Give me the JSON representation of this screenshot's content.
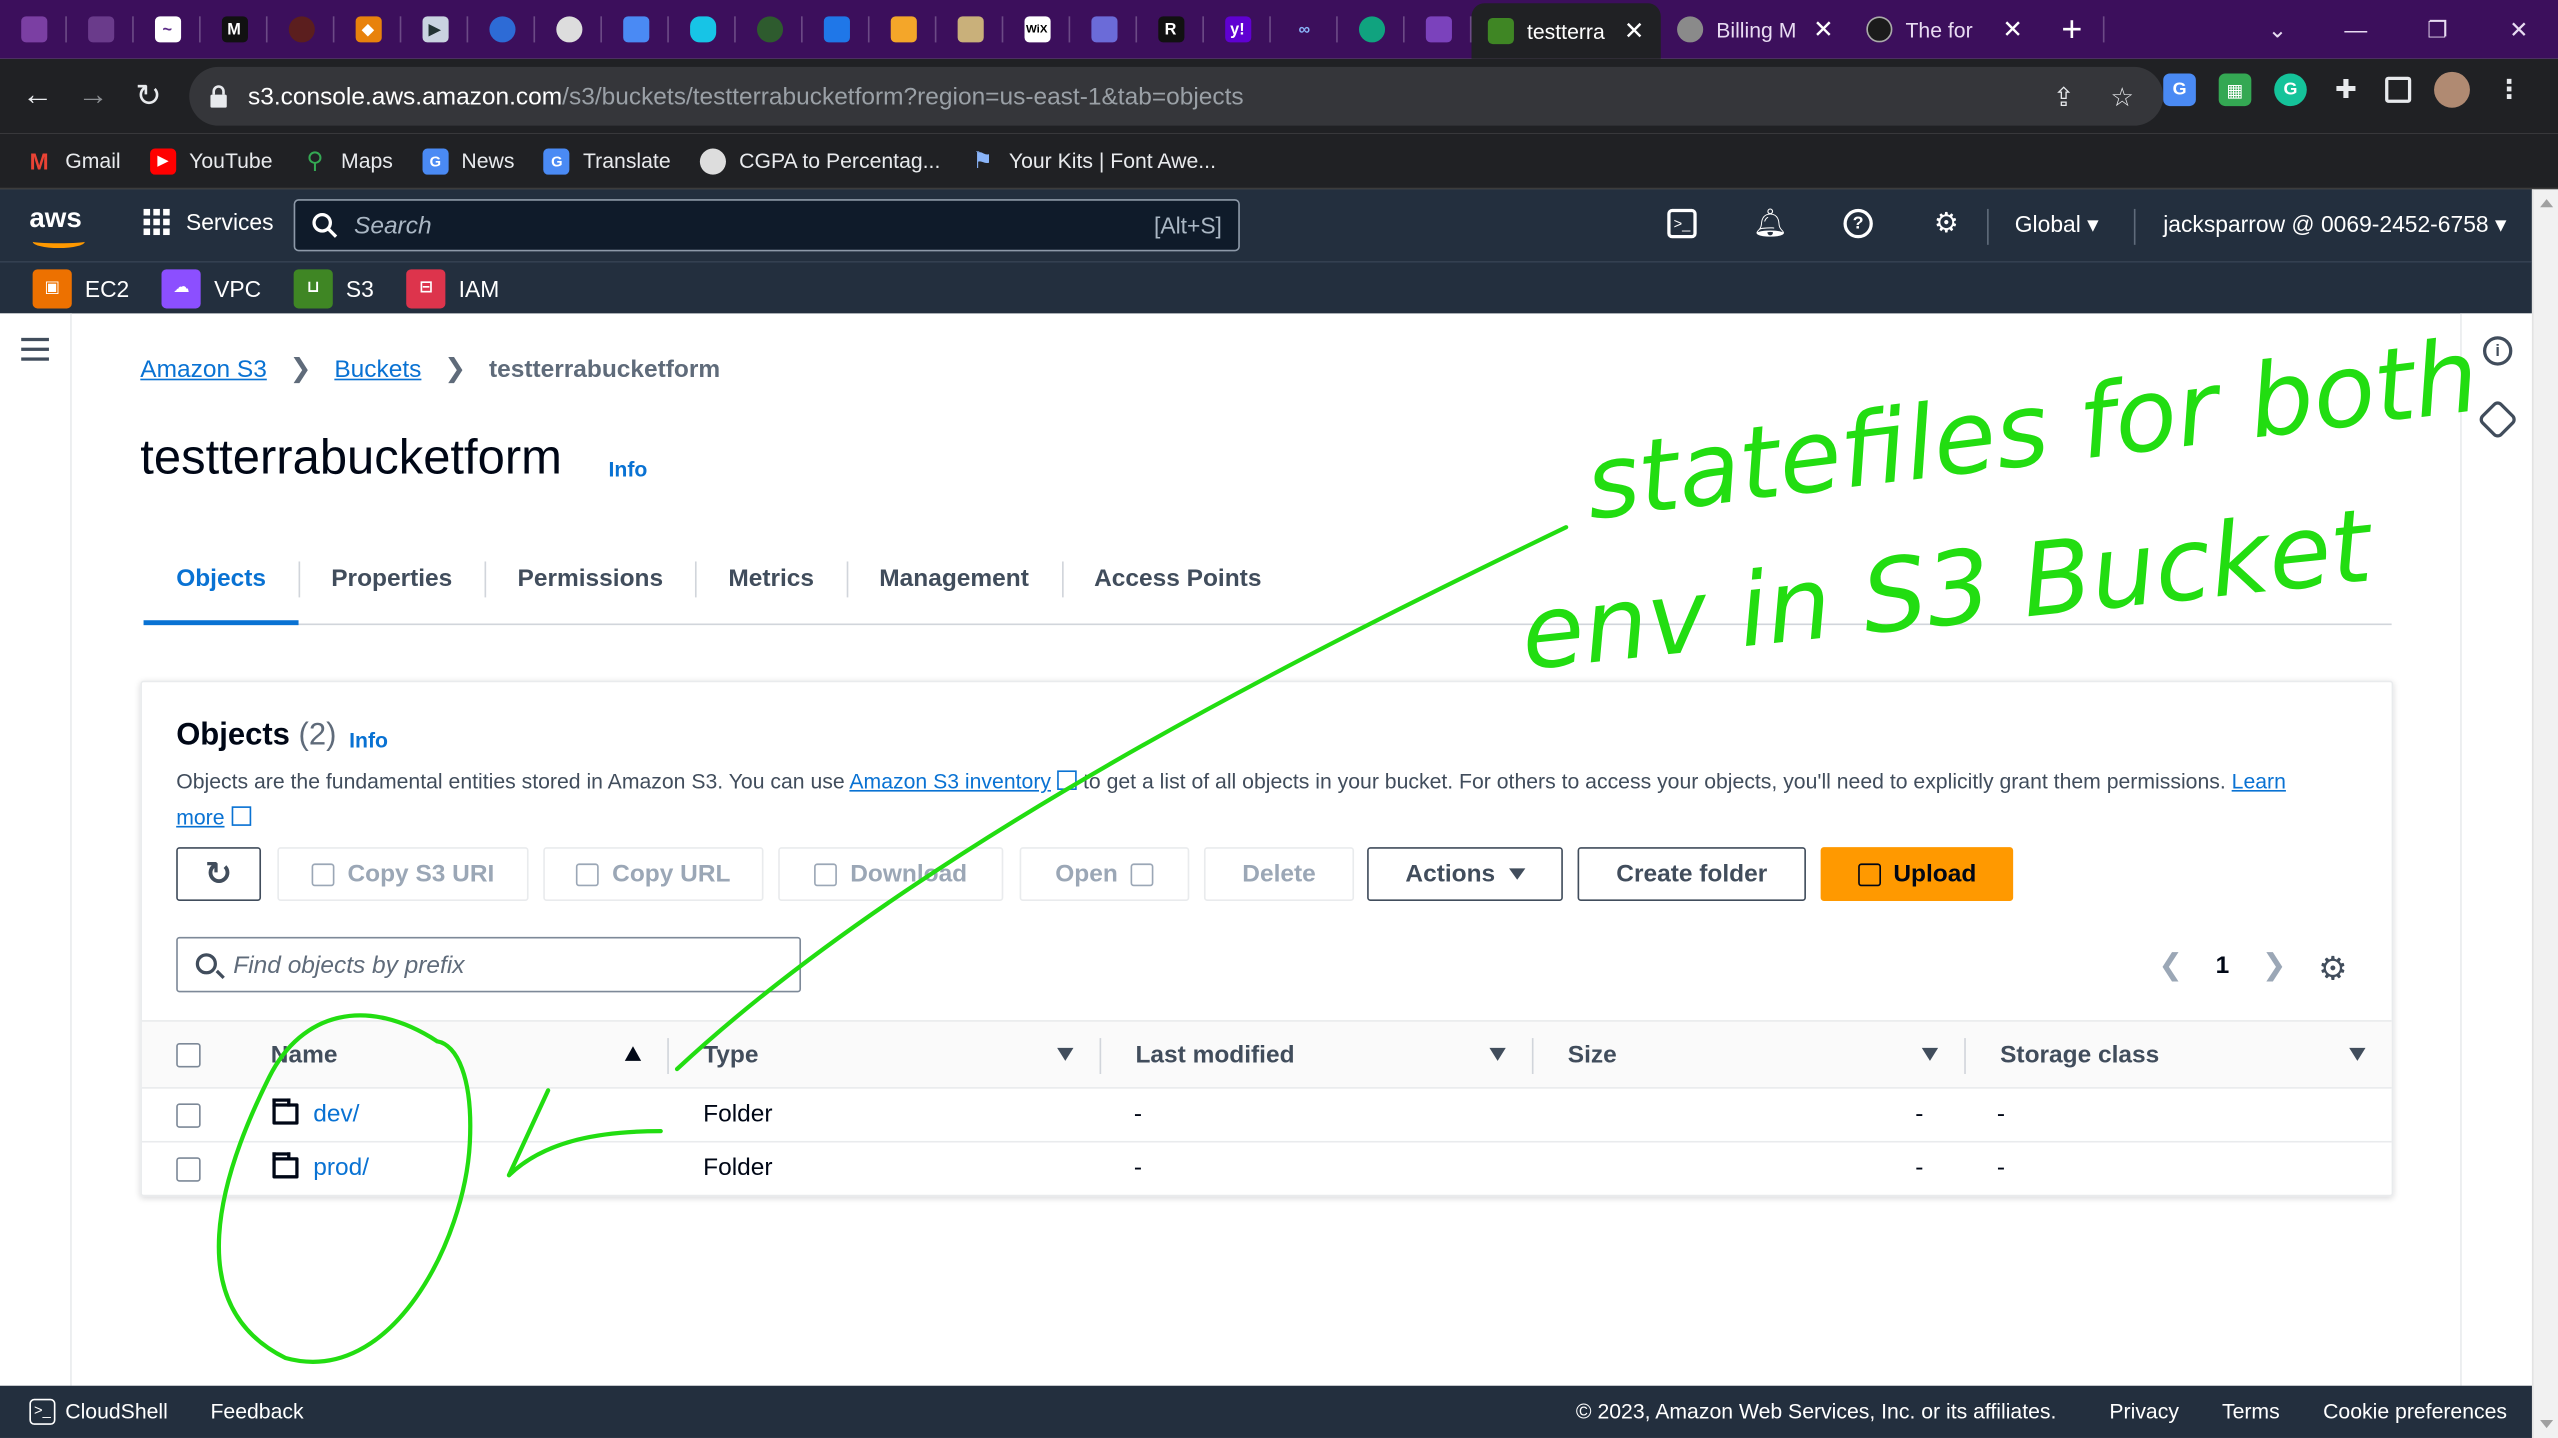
{
  "browser": {
    "tabs": [
      {
        "title": "testterra",
        "active": true
      },
      {
        "title": "Billing M",
        "active": false
      },
      {
        "title": "The for",
        "active": false
      }
    ],
    "url_host": "s3.console.aws.amazon.com",
    "url_rest": "/s3/buckets/testterrabucketform?region=us-east-1&tab=objects",
    "bookmarks": [
      "Gmail",
      "YouTube",
      "Maps",
      "News",
      "Translate",
      "CGPA to Percentag...",
      "Your Kits | Font Awe..."
    ]
  },
  "aws_nav": {
    "logo": "aws",
    "services_label": "Services",
    "search_placeholder": "Search",
    "search_shortcut": "[Alt+S]",
    "region": "Global ▾",
    "account": "jacksparrow @ 0069-2452-6758 ▾",
    "favorites": [
      "EC2",
      "VPC",
      "S3",
      "IAM"
    ]
  },
  "breadcrumb": [
    "Amazon S3",
    "Buckets",
    "testterrabucketform"
  ],
  "page": {
    "title": "testterrabucketform",
    "info": "Info"
  },
  "tabs": [
    "Objects",
    "Properties",
    "Permissions",
    "Metrics",
    "Management",
    "Access Points"
  ],
  "objects_panel": {
    "title": "Objects",
    "count": "(2)",
    "info": "Info",
    "desc_before": "Objects are the fundamental entities stored in Amazon S3. You can use ",
    "desc_link": "Amazon S3 inventory",
    "desc_after": " to get a list of all objects in your bucket. For others to access your objects, you'll need to explicitly grant them permissions. ",
    "desc_learn": "Learn",
    "desc_more": "more",
    "buttons": {
      "copy_s3_uri": "Copy S3 URI",
      "copy_url": "Copy URL",
      "download": "Download",
      "open": "Open",
      "delete": "Delete",
      "actions": "Actions",
      "create_folder": "Create folder",
      "upload": "Upload"
    },
    "filter_placeholder": "Find objects by prefix",
    "page_number": "1",
    "columns": [
      "Name",
      "Type",
      "Last modified",
      "Size",
      "Storage class"
    ],
    "rows": [
      {
        "name": "dev/",
        "type": "Folder",
        "last_modified": "-",
        "size": "-",
        "storage_class": "-"
      },
      {
        "name": "prod/",
        "type": "Folder",
        "last_modified": "-",
        "size": "-",
        "storage_class": "-"
      }
    ]
  },
  "annotation": {
    "line1": "statefiles for both",
    "line2": "env in S3 Bucket",
    "color": "#22dd11"
  },
  "footer": {
    "cloudshell": "CloudShell",
    "feedback": "Feedback",
    "copyright": "© 2023, Amazon Web Services, Inc. or its affiliates.",
    "privacy": "Privacy",
    "terms": "Terms",
    "cookie": "Cookie preferences"
  },
  "colors": {
    "tabstrip": "#3c0f5c",
    "aws_nav": "#232f3e",
    "link": "#0972d3",
    "upload": "#ff9900"
  }
}
